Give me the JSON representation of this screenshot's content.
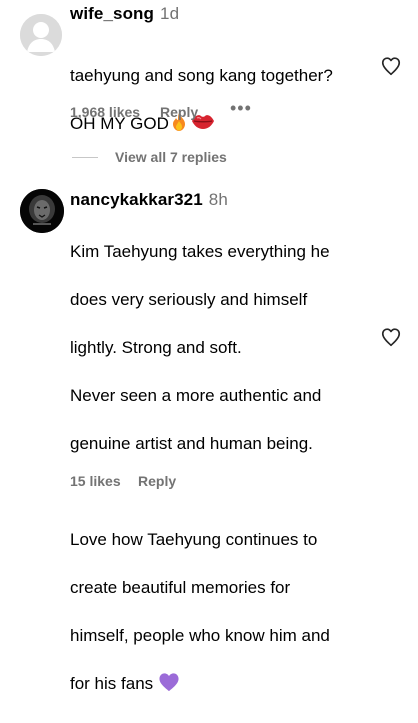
{
  "comments": [
    {
      "username": "wife_song",
      "time": "1d",
      "lines": [
        "taehyung and song kang together?",
        "OH MY GOD"
      ],
      "likes": "1,968 likes",
      "reply_label": "Reply",
      "more_icon": "more-dots-icon",
      "view_replies": "View all 7 replies"
    },
    {
      "username": "nancykakkar321",
      "time": "8h",
      "lines": [
        "Kim Taehyung takes everything he",
        "does very seriously and himself",
        "lightly. Strong and soft.",
        "Never seen a more authentic and",
        "genuine artist and human being.",
        "",
        "Love how Taehyung continues to",
        "create beautiful memories for",
        "himself, people who know him and",
        "for his fans"
      ],
      "likes": "15 likes",
      "reply_label": "Reply"
    }
  ],
  "colors": {
    "secondary_text": "#737373",
    "heart_outline": "#262626",
    "avatar_placeholder": "#dbdbdb"
  },
  "icons": {
    "like": "heart-outline-icon",
    "fire": "fire-emoji",
    "lips": "lips-emoji",
    "purple_heart": "purple-heart-emoji"
  }
}
